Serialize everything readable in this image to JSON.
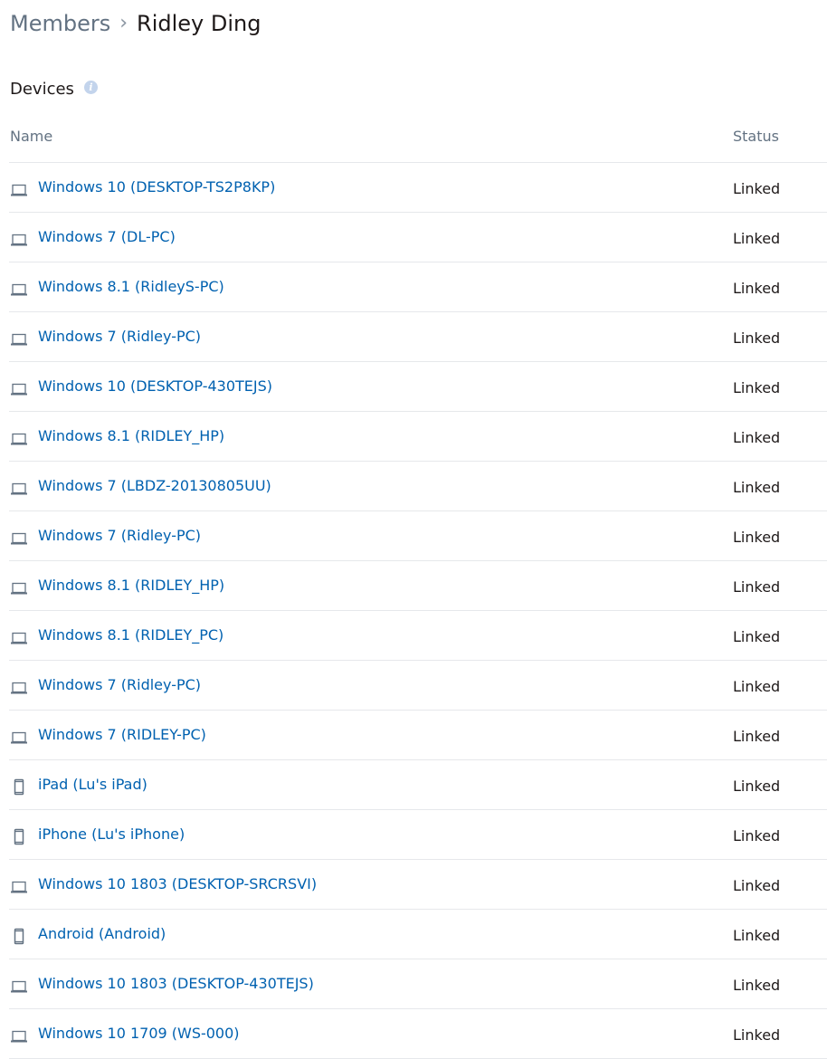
{
  "breadcrumb": {
    "parent": "Members",
    "separator": "›",
    "current": "Ridley Ding"
  },
  "section": {
    "title": "Devices",
    "info_icon": "info-icon"
  },
  "table": {
    "columns": {
      "name": "Name",
      "status": "Status"
    },
    "rows": [
      {
        "type": "computer",
        "name": "Windows 10 (DESKTOP-TS2P8KP)",
        "status": "Linked"
      },
      {
        "type": "computer",
        "name": "Windows 7 (DL-PC)",
        "status": "Linked"
      },
      {
        "type": "computer",
        "name": "Windows 8.1 (RidleyS-PC)",
        "status": "Linked"
      },
      {
        "type": "computer",
        "name": "Windows 7 (Ridley-PC)",
        "status": "Linked"
      },
      {
        "type": "computer",
        "name": "Windows 10 (DESKTOP-430TEJS)",
        "status": "Linked"
      },
      {
        "type": "computer",
        "name": "Windows 8.1 (RIDLEY_HP)",
        "status": "Linked"
      },
      {
        "type": "computer",
        "name": "Windows 7 (LBDZ-20130805UU)",
        "status": "Linked"
      },
      {
        "type": "computer",
        "name": "Windows 7 (Ridley-PC)",
        "status": "Linked"
      },
      {
        "type": "computer",
        "name": "Windows 8.1 (RIDLEY_HP)",
        "status": "Linked"
      },
      {
        "type": "computer",
        "name": "Windows 8.1 (RIDLEY_PC)",
        "status": "Linked"
      },
      {
        "type": "computer",
        "name": "Windows 7 (Ridley-PC)",
        "status": "Linked"
      },
      {
        "type": "computer",
        "name": "Windows 7 (RIDLEY-PC)",
        "status": "Linked"
      },
      {
        "type": "mobile",
        "name": "iPad (Lu's iPad)",
        "status": "Linked"
      },
      {
        "type": "mobile",
        "name": "iPhone (Lu's iPhone)",
        "status": "Linked"
      },
      {
        "type": "computer",
        "name": "Windows 10 1803 (DESKTOP-SRCRSVI)",
        "status": "Linked"
      },
      {
        "type": "mobile",
        "name": "Android (Android)",
        "status": "Linked"
      },
      {
        "type": "computer",
        "name": "Windows 10 1803 (DESKTOP-430TEJS)",
        "status": "Linked"
      },
      {
        "type": "computer",
        "name": "Windows 10 1709 (WS-000)",
        "status": "Linked"
      }
    ]
  },
  "colors": {
    "link": "#0061b0",
    "text": "#1e1919",
    "muted": "#637282",
    "divider": "#e6e8eb",
    "icon": "#637282",
    "info_icon": "#c3d4ec"
  }
}
